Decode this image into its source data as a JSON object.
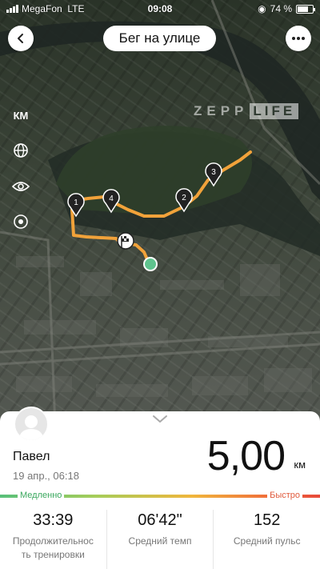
{
  "status_bar": {
    "carrier": "MegaFon",
    "network": "LTE",
    "time": "09:08",
    "battery": "74 %",
    "battery_level": 0.74
  },
  "header": {
    "title": "Бег на улице",
    "back_icon": "chevron-left-icon",
    "more_icon": "more-dots-icon"
  },
  "map": {
    "brand_left": "ZEPP",
    "brand_right": "LIFE",
    "unit_button": "КМ",
    "route_color": "#f1a23a",
    "end_marker_color": "#5fc48e",
    "km_markers": [
      "1",
      "2",
      "3",
      "4"
    ],
    "side_icons": [
      "globe-icon",
      "eye-icon",
      "locate-icon"
    ]
  },
  "summary": {
    "user_name": "Павел",
    "date": "19 апр., 06:18",
    "distance": "5,00",
    "distance_unit": "км"
  },
  "pace_scale": {
    "slow_label": "Медленно",
    "fast_label": "Быстро"
  },
  "stats": [
    {
      "value": "33:39",
      "label": "Продолжительнос ть тренировки"
    },
    {
      "value": "06'42\"",
      "label": "Средний темп"
    },
    {
      "value": "152",
      "label": "Средний пульс"
    }
  ]
}
